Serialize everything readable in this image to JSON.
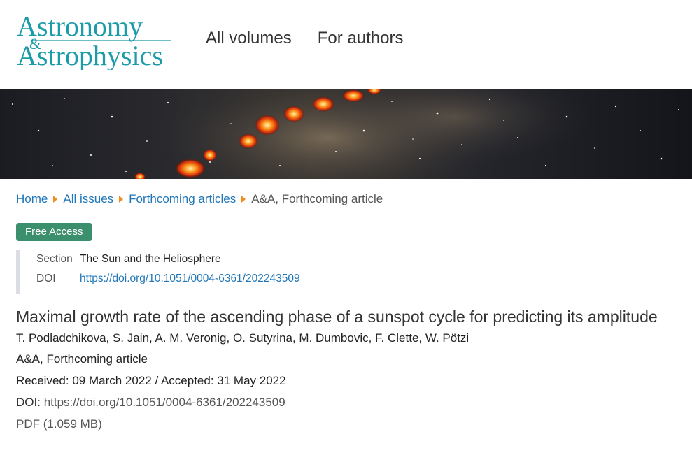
{
  "header": {
    "logo": {
      "line1": "Astronomy",
      "ampersand": "&",
      "line2": "Astrophysics",
      "color": "#1c9ba8"
    },
    "nav": [
      {
        "label": "All volumes"
      },
      {
        "label": "For authors"
      }
    ]
  },
  "breadcrumb": {
    "items": [
      {
        "label": "Home"
      },
      {
        "label": "All issues"
      },
      {
        "label": "Forthcoming articles"
      }
    ],
    "current": "A&A, Forthcoming article",
    "separator_color": "#f08c1a"
  },
  "badge": {
    "label": "Free Access",
    "color": "#3b8f6c"
  },
  "meta": {
    "section_label": "Section",
    "section_value": "The Sun and the Heliosphere",
    "doi_label": "DOI",
    "doi_value": "https://doi.org/10.1051/0004-6361/202243509"
  },
  "article": {
    "title": "Maximal growth rate of the ascending phase of a sunspot cycle for predicting its amplitude",
    "authors": "T. Podladchikova, S. Jain, A. M. Veronig, O. Sutyrina, M. Dumbovic, F. Clette, W. Pötzi",
    "journal": "A&A, Forthcoming article",
    "dates": "Received: 09 March 2022 / Accepted: 31 May 2022",
    "doi_label": "DOI:",
    "doi_value": "https://doi.org/10.1051/0004-6361/202243509",
    "pdf": "PDF (1.059 MB)"
  },
  "colors": {
    "link": "#1f76b8",
    "accent": "#1c9ba8"
  }
}
